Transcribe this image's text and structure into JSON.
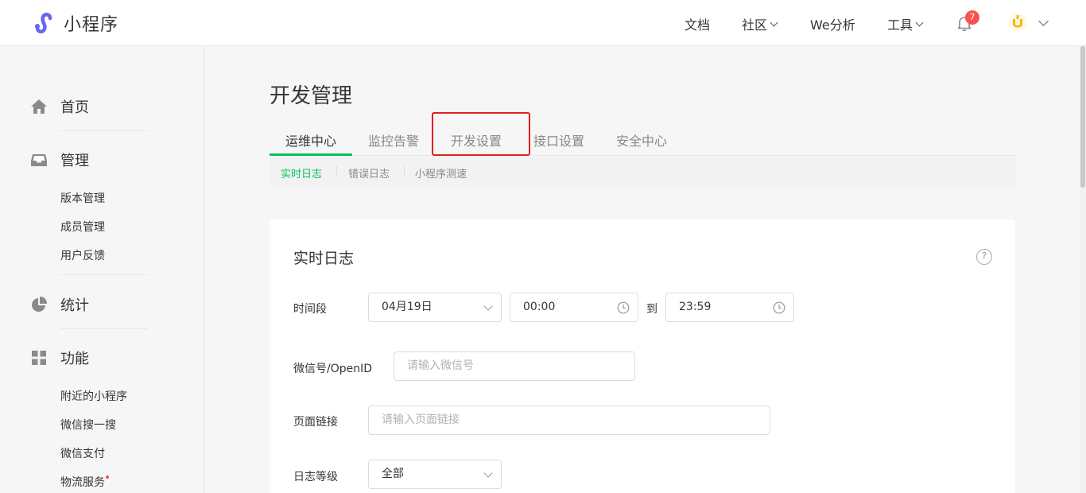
{
  "header": {
    "logo_text": "小程序",
    "nav": {
      "docs": "文档",
      "community": "社区",
      "we_analysis": "We分析",
      "tools": "工具"
    },
    "notification_count": "7"
  },
  "sidebar": {
    "home": "首页",
    "manage": "管理",
    "manage_items": [
      "版本管理",
      "成员管理",
      "用户反馈"
    ],
    "stats": "统计",
    "features": "功能",
    "feature_items": [
      "附近的小程序",
      "微信搜一搜",
      "微信支付",
      "物流服务"
    ]
  },
  "main": {
    "title": "开发管理",
    "tabs": [
      "运维中心",
      "监控告警",
      "开发设置",
      "接口设置",
      "安全中心"
    ],
    "subtabs": [
      "实时日志",
      "错误日志",
      "小程序测速"
    ],
    "card": {
      "title": "实时日志",
      "help": "?",
      "time_label": "时间段",
      "date_value": "04月19日",
      "start_time": "00:00",
      "to": "到",
      "end_time": "23:59",
      "openid_label": "微信号/OpenID",
      "openid_placeholder": "请输入微信号",
      "page_label": "页面链接",
      "page_placeholder": "请输入页面链接",
      "level_label": "日志等级",
      "level_value": "全部"
    }
  },
  "colors": {
    "accent": "#07c160",
    "highlight": "#e02020",
    "badge": "#fa5151"
  }
}
